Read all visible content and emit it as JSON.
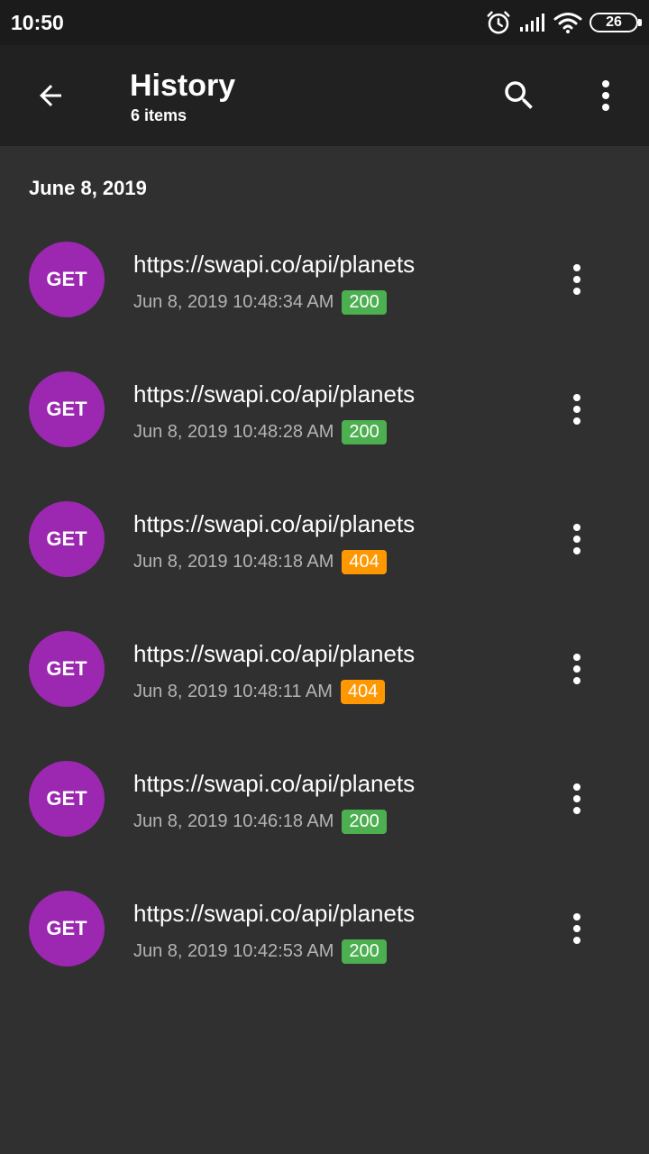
{
  "status_bar": {
    "time": "10:50",
    "icons": [
      "alarm-icon",
      "signal-icon",
      "wifi-icon",
      "battery-icon"
    ],
    "battery": "26"
  },
  "app_bar": {
    "title": "History",
    "subtitle": "6 items",
    "icons": [
      "back-arrow-icon",
      "search-icon",
      "overflow-menu-icon"
    ]
  },
  "section": {
    "date": "June 8, 2019"
  },
  "colors": {
    "method_bg": "#9c27b0",
    "status_ok": "#4caf50",
    "status_error": "#ff9800"
  },
  "items": [
    {
      "method": "GET",
      "url": "https://swapi.co/api/planets",
      "time": "Jun 8, 2019 10:48:34 AM",
      "status": "200",
      "status_color": "#4caf50"
    },
    {
      "method": "GET",
      "url": "https://swapi.co/api/planets",
      "time": "Jun 8, 2019 10:48:28 AM",
      "status": "200",
      "status_color": "#4caf50"
    },
    {
      "method": "GET",
      "url": "https://swapi.co/api/planets",
      "time": "Jun 8, 2019 10:48:18 AM",
      "status": "404",
      "status_color": "#ff9800"
    },
    {
      "method": "GET",
      "url": "https://swapi.co/api/planets",
      "time": "Jun 8, 2019 10:48:11 AM",
      "status": "404",
      "status_color": "#ff9800"
    },
    {
      "method": "GET",
      "url": "https://swapi.co/api/planets",
      "time": "Jun 8, 2019 10:46:18 AM",
      "status": "200",
      "status_color": "#4caf50"
    },
    {
      "method": "GET",
      "url": "https://swapi.co/api/planets",
      "time": "Jun 8, 2019 10:42:53 AM",
      "status": "200",
      "status_color": "#4caf50"
    }
  ]
}
